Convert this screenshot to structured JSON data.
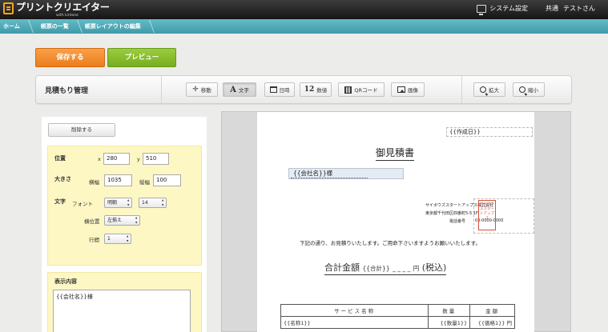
{
  "app": {
    "logo_text": "プリントクリエイター",
    "logo_sub": "with kintone",
    "system_settings": "システム設定",
    "user_group": "共通",
    "user_name": "テストさん"
  },
  "breadcrumbs": [
    "ホーム",
    "帳票の一覧",
    "帳票レイアウトの編集"
  ],
  "actions": {
    "save": "保存する",
    "preview": "プレビュー"
  },
  "toolbar": {
    "title": "見積もり管理",
    "buttons": {
      "move": "移動",
      "text": "文字",
      "date": "日時",
      "number": "数値",
      "qr": "QRコード",
      "image": "画像",
      "zoom_in": "拡大",
      "zoom_out": "縮小"
    },
    "number_icon_text": "12"
  },
  "panel": {
    "delete": "削除する",
    "position_label": "位置",
    "x_label": "x",
    "x_value": "280",
    "y_label": "y",
    "y_value": "510",
    "size_label": "大きさ",
    "width_label": "横幅",
    "width_value": "1035",
    "height_label": "縦幅",
    "height_value": "100",
    "text_label": "文字",
    "font_label": "フォント",
    "font_value": "明朝",
    "font_size_value": "14",
    "halign_label": "横位置",
    "halign_value": "左揃え",
    "line_spacing_label": "行間",
    "line_spacing_value": "1",
    "content_label": "表示内容",
    "content_value": "{{会社名}}様"
  },
  "document": {
    "created_field": "{{作成日}}",
    "title": "御見積書",
    "company_field": "{{会社名}}様",
    "issuer_name": "サイボウズスタートアップス株式会社",
    "issuer_address": "東京都千代田区四番町5-5 1F",
    "issuer_phone_label": "電話番号",
    "issuer_phone": "03-0000-0000",
    "stamp_text": "サイボウズスタートアップス",
    "greeting": "下記の通り、お見積りいたします。ご用命下さいますようお願いいたします。",
    "total_label": "合計金額",
    "total_field": "{{合計}}",
    "total_unit": "円",
    "tax_note": "(税込)",
    "table_headers": [
      "サービス名称",
      "数量",
      "金額"
    ],
    "table_row": [
      "{{名称1}}",
      "{{数量1}}",
      "{{価格1}}",
      "円"
    ]
  }
}
